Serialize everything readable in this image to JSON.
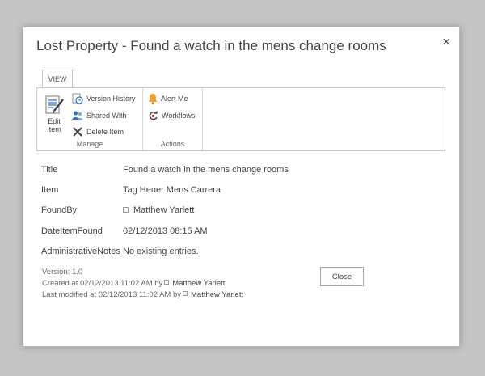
{
  "dialog": {
    "title": "Lost Property - Found a watch in the mens change rooms",
    "close_icon": "×"
  },
  "ribbon": {
    "tab": "VIEW",
    "manage": {
      "label": "Manage",
      "edit_item": [
        "Edit",
        "Item"
      ],
      "version_history": "Version History",
      "shared_with": "Shared With",
      "delete_item": "Delete Item"
    },
    "actions": {
      "label": "Actions",
      "alert_me": "Alert Me",
      "workflows": "Workflows"
    },
    "icons": [
      "edit-item-icon",
      "version-history-icon",
      "shared-with-icon",
      "delete-item-icon",
      "alert-me-icon",
      "workflows-icon"
    ]
  },
  "fields": [
    {
      "label": "Title",
      "value": "Found a watch in the mens change rooms"
    },
    {
      "label": "Item",
      "value": "Tag Heuer Mens Carrera"
    },
    {
      "label": "FoundBy",
      "value": "Matthew Yarlett"
    },
    {
      "label": "DateItemFound",
      "value": "02/12/2013 08:15 AM"
    },
    {
      "label": "AdministrativeNotes",
      "value": "No existing entries."
    }
  ],
  "meta": {
    "version": "Version: 1.0",
    "created_prefix": "Created at 02/12/2013 11:02 AM  by",
    "created_by": "Matthew Yarlett",
    "modified_prefix": "Last modified at 02/12/2013 11:02 AM  by",
    "modified_by": "Matthew Yarlett"
  },
  "footer": {
    "close_label": "Close"
  },
  "colors": {
    "background": "#c4c4c4",
    "text": "#444444",
    "accent_blue": "#2a6fbf",
    "alert_orange": "#f0a030",
    "delete_dark": "#444444"
  }
}
